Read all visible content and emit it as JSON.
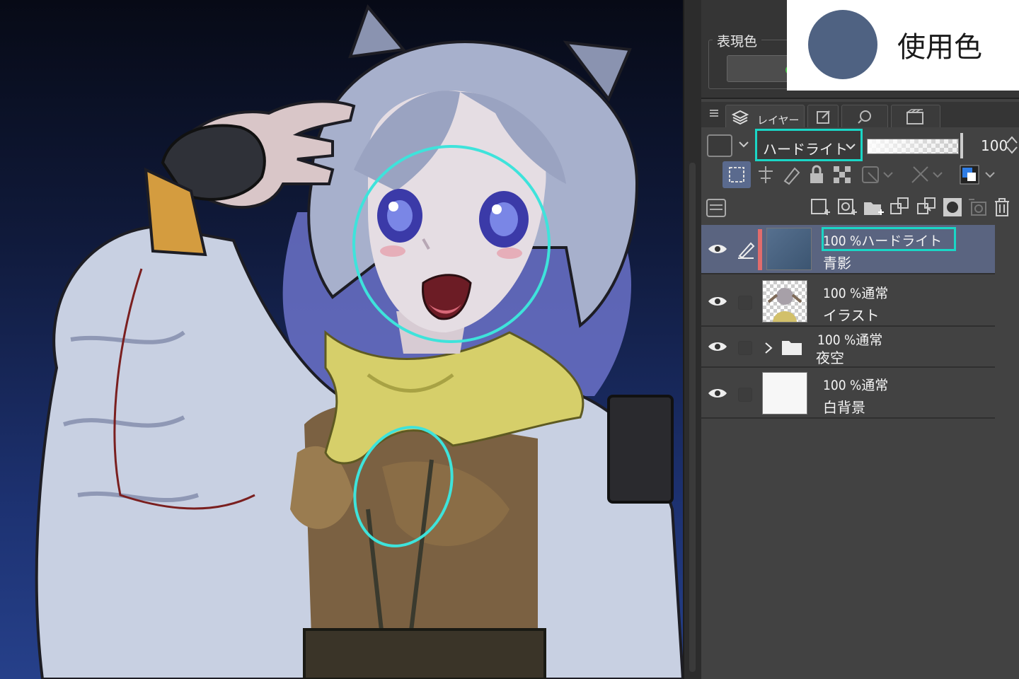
{
  "used_color": {
    "label": "使用色",
    "swatch": "#4f6282"
  },
  "color_expression": {
    "label": "表現色"
  },
  "tabs": {
    "layer_label": "レイヤー"
  },
  "blend": {
    "mode_label": "ハードライト",
    "opacity_value": "100"
  },
  "layers": [
    {
      "mode": "100 %ハードライト",
      "name": "青影"
    },
    {
      "mode": "100 %通常",
      "name": "イラスト"
    },
    {
      "mode": "100 %通常",
      "name": "夜空"
    },
    {
      "mode": "100 %通常",
      "name": "白背景"
    }
  ],
  "colors": {
    "highlight": "#1ad6c6",
    "selected_row": "#5a6480",
    "panel_bg": "#424242"
  }
}
